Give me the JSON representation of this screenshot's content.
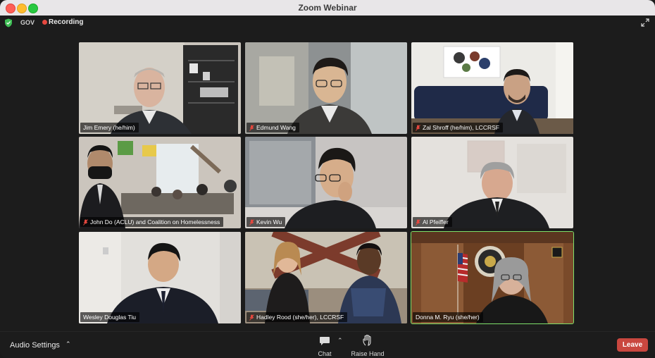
{
  "window": {
    "title": "Zoom Webinar"
  },
  "topbar": {
    "gov_label": "GOV",
    "recording_label": "Recording"
  },
  "participants": [
    {
      "name": "Jim Emery (he/him)",
      "muted": false
    },
    {
      "name": "Edmund Wang",
      "muted": true
    },
    {
      "name": "Zal Shroff (he/him), LCCRSF",
      "muted": true
    },
    {
      "name": "John Do (ACLU) and Coalition on Homelessness",
      "muted": true
    },
    {
      "name": "Kevin Wu",
      "muted": true
    },
    {
      "name": "Al Pfeiffer",
      "muted": true
    },
    {
      "name": "Wesley Douglas Tiu",
      "muted": false
    },
    {
      "name": "Hadley Rood (she/her), LCCRSF",
      "muted": true
    },
    {
      "name": "Donna M. Ryu (she/her)",
      "muted": false,
      "active_speaker": true
    }
  ],
  "toolbar": {
    "audio_settings_label": "Audio Settings",
    "chat_label": "Chat",
    "raise_hand_label": "Raise Hand",
    "leave_label": "Leave"
  },
  "colors": {
    "leave_button": "#c9473f",
    "recording_dot": "#e5483f",
    "active_speaker_border": "#7ee06a",
    "shield": "#3fbf55"
  },
  "icons": [
    "shield-check-icon",
    "recording-dot-icon",
    "expand-icon",
    "muted-mic-icon",
    "chat-bubble-icon",
    "raise-hand-icon",
    "caret-up-icon"
  ]
}
